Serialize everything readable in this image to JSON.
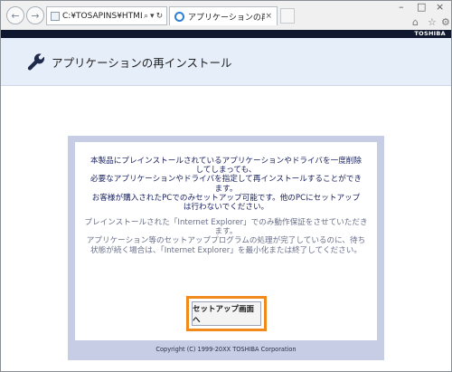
{
  "browser": {
    "address_url": "C:¥TOSAPINS¥HTML¥SET!",
    "search_glyph": "⌕",
    "refresh_glyph": "↻",
    "tab_title": "アプリケーションの再インストール",
    "tab_close": "×",
    "minimize": "–",
    "maximize": "□",
    "close": "×",
    "home_glyph": "⌂",
    "star_glyph": "☆",
    "gear_glyph": "⚙",
    "back_glyph": "←",
    "forward_glyph": "→"
  },
  "brand": "TOSHIBA",
  "header": {
    "title": "アプリケーションの再インストール",
    "icon": "wrench-icon"
  },
  "content": {
    "notice_lines": [
      "本製品にプレインストールされているアプリケーションやドライバを一度削除",
      "してしまっても、",
      "必要なアプリケーションやドライバを指定して再インストールすることができ",
      "ます。",
      "お客様が購入されたPCでのみセットアップ可能です。他のPCにセットアップ",
      "は行わないでください。"
    ],
    "info_lines": [
      "プレインストールされた「Internet Explorer」でのみ動作保証をさせていただき",
      "ます。",
      "アプリケーション等のセットアッププログラムの処理が完了しているのに、待ち",
      "状態が続く場合は、「Internet Explorer」を最小化または終了してください。"
    ],
    "setup_button": "セットアップ画面へ",
    "copyright": "Copyright (C) 1999-20XX TOSHIBA Corporation"
  },
  "colors": {
    "brandbar": "#101830",
    "header_bg": "#e6eefa",
    "panel_bg": "#c8cde6",
    "notice_text": "#1a2260",
    "info_text": "#6a7089",
    "button_highlight": "#f08a1c"
  }
}
